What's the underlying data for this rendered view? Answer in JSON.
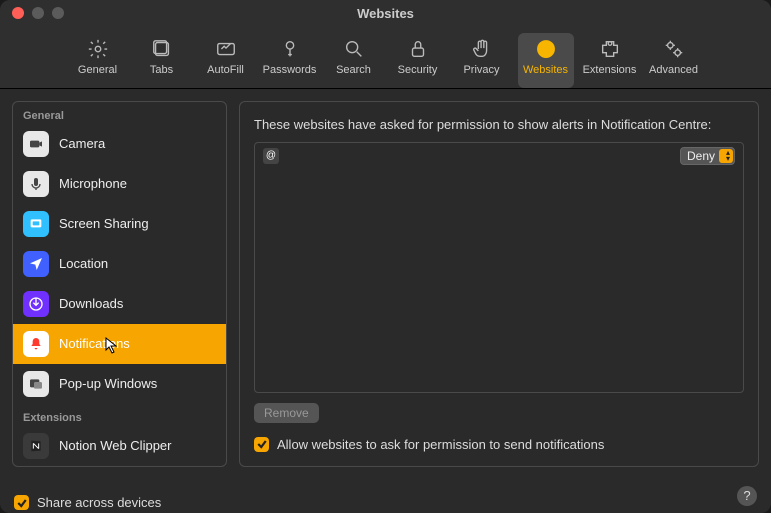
{
  "window": {
    "title": "Websites"
  },
  "toolbar": {
    "items": [
      {
        "label": "General",
        "icon": "gear"
      },
      {
        "label": "Tabs",
        "icon": "tabs"
      },
      {
        "label": "AutoFill",
        "icon": "autofill"
      },
      {
        "label": "Passwords",
        "icon": "key"
      },
      {
        "label": "Search",
        "icon": "search"
      },
      {
        "label": "Security",
        "icon": "lock"
      },
      {
        "label": "Privacy",
        "icon": "hand"
      },
      {
        "label": "Websites",
        "icon": "globe",
        "active": true
      },
      {
        "label": "Extensions",
        "icon": "puzzle"
      },
      {
        "label": "Advanced",
        "icon": "gears"
      }
    ]
  },
  "sidebar": {
    "groups": [
      {
        "header": "General",
        "items": [
          {
            "label": "Camera",
            "icon": "camera",
            "bg": "#e8e8e8"
          },
          {
            "label": "Microphone",
            "icon": "mic",
            "bg": "#e8e8e8"
          },
          {
            "label": "Screen Sharing",
            "icon": "screen",
            "bg": "#30c0ff"
          },
          {
            "label": "Location",
            "icon": "location",
            "bg": "#4060ff"
          },
          {
            "label": "Downloads",
            "icon": "download",
            "bg": "#7030ff"
          },
          {
            "label": "Notifications",
            "icon": "bell",
            "bg": "#ffffff",
            "selected": true
          },
          {
            "label": "Pop-up Windows",
            "icon": "popup",
            "bg": "#e8e8e8"
          }
        ]
      },
      {
        "header": "Extensions",
        "items": [
          {
            "label": "Notion Web Clipper",
            "icon": "notion",
            "bg": "#3a3a3a"
          }
        ]
      }
    ]
  },
  "main": {
    "description": "These websites have asked for permission to show alerts in Notification Centre:",
    "rows": [
      {
        "site": "",
        "favicon": "@",
        "permission": "Deny"
      }
    ],
    "remove_label": "Remove",
    "allow_checkbox": {
      "checked": true,
      "label": "Allow websites to ask for permission to send notifications"
    }
  },
  "footer": {
    "share": {
      "checked": true,
      "label": "Share across devices"
    },
    "help_label": "?"
  }
}
